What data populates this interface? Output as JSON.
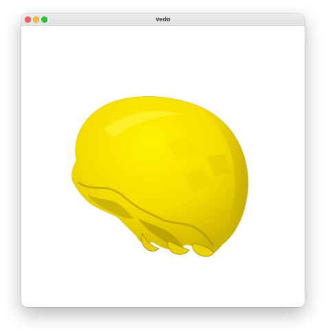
{
  "window": {
    "title": "vedo",
    "controls": {
      "close_icon": "close-icon",
      "minimize_icon": "minimize-icon",
      "zoom_icon": "zoom-icon"
    }
  },
  "viewport": {
    "background": "#ffffff",
    "mesh": {
      "name": "skull-mesh",
      "color": "#ffe600"
    }
  }
}
